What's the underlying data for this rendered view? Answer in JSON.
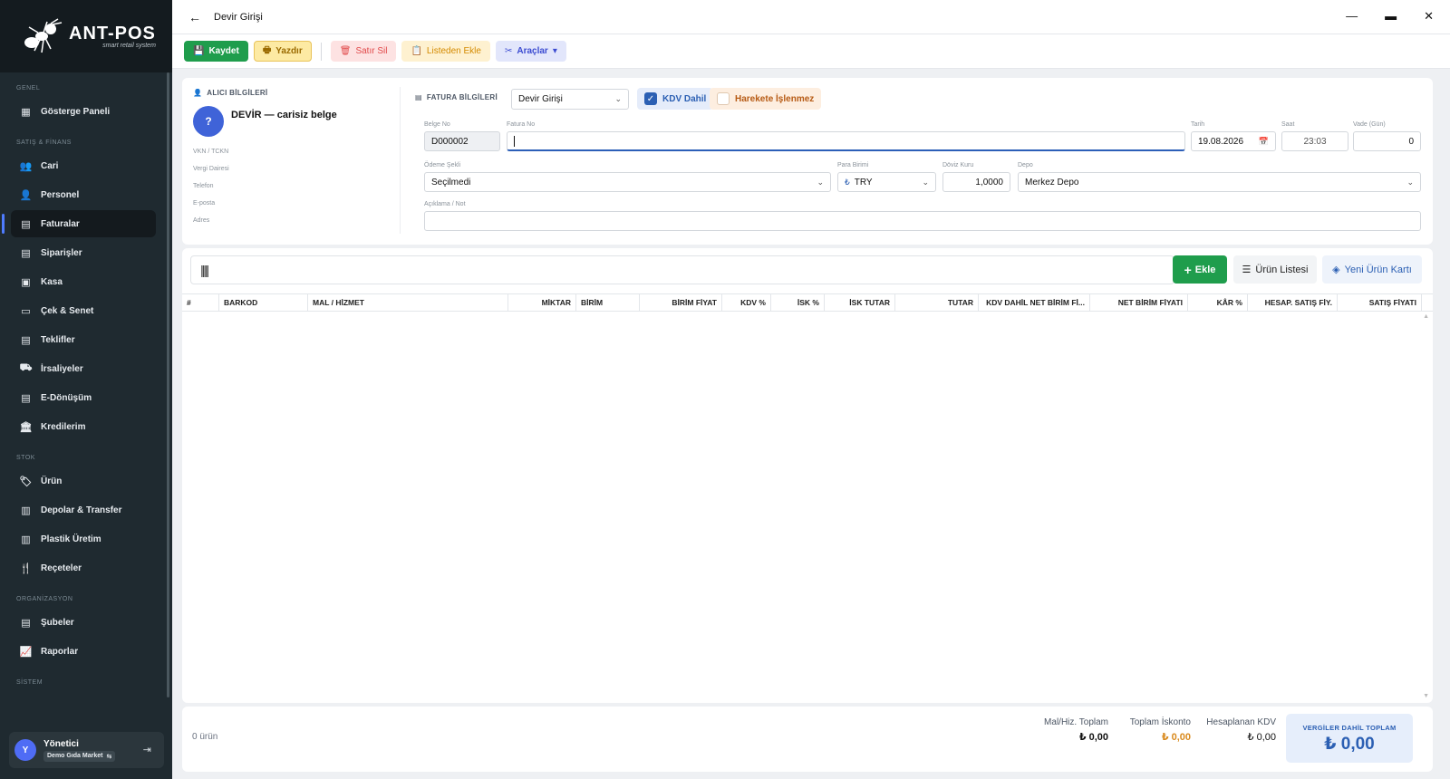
{
  "app": {
    "logo_title": "ANT-POS",
    "logo_subtitle": "smart retail system",
    "window_title": "Devir Girişi"
  },
  "sidebar": {
    "sections": {
      "genel": "GENEL",
      "satis": "SATIŞ & FİNANS",
      "stok": "STOK",
      "org": "ORGANİZASYON",
      "sistem": "SİSTEM"
    },
    "items": [
      {
        "label": "Gösterge Paneli",
        "icon": "dashboard-icon"
      },
      {
        "label": "Cari",
        "icon": "users-icon"
      },
      {
        "label": "Personel",
        "icon": "user-gear-icon"
      },
      {
        "label": "Faturalar",
        "icon": "invoice-icon",
        "active": true
      },
      {
        "label": "Siparişler",
        "icon": "order-icon"
      },
      {
        "label": "Kasa",
        "icon": "cashbox-icon"
      },
      {
        "label": "Çek & Senet",
        "icon": "cheque-icon"
      },
      {
        "label": "Teklifler",
        "icon": "offer-icon"
      },
      {
        "label": "İrsaliyeler",
        "icon": "truck-icon"
      },
      {
        "label": "E-Dönüşüm",
        "icon": "e-document-icon"
      },
      {
        "label": "Kredilerim",
        "icon": "bank-icon"
      },
      {
        "label": "Ürün",
        "icon": "tag-icon"
      },
      {
        "label": "Depolar & Transfer",
        "icon": "warehouse-icon"
      },
      {
        "label": "Plastik Üretim",
        "icon": "factory-icon"
      },
      {
        "label": "Reçeteler",
        "icon": "utensils-icon"
      },
      {
        "label": "Şubeler",
        "icon": "building-icon"
      },
      {
        "label": "Raporlar",
        "icon": "chart-line-icon"
      }
    ],
    "user": {
      "initial": "Y",
      "name": "Yönetici",
      "branch": "Demo Gıda Market",
      "switch_glyph": "⇆"
    }
  },
  "toolbar": {
    "save": "Kaydet",
    "print": "Yazdır",
    "delete_row": "Satır Sil",
    "add_from_list": "Listeden Ekle",
    "tools": "Araçlar"
  },
  "buyer": {
    "title": "ALICI BİLGİLERİ",
    "avatar": "?",
    "name": "DEVİR — carisiz belge",
    "fields": [
      "VKN / TCKN",
      "Vergi Dairesi",
      "Telefon",
      "E-posta",
      "Adres"
    ]
  },
  "invoice": {
    "title": "FATURA BİLGİLERİ",
    "type_value": "Devir Girişi",
    "kdv_dahil": "KDV Dahil",
    "kdv_dahil_checked": true,
    "hareket": "Harekete İşlenmez",
    "hareket_checked": false,
    "belge_no_label": "Belge No",
    "belge_no": "D000002",
    "fatura_no_label": "Fatura No",
    "fatura_no": "",
    "tarih_label": "Tarih",
    "tarih": "19.08.2026",
    "saat_label": "Saat",
    "saat": "23:03",
    "vade_label": "Vade (Gün)",
    "vade": "0",
    "odeme_label": "Ödeme Şekli",
    "odeme": "Seçilmedi",
    "para_label": "Para Birimi",
    "para_symbol": "₺",
    "para": "TRY",
    "doviz_label": "Döviz Kuru",
    "doviz": "1,0000",
    "depo_label": "Depo",
    "depo": "Merkez Depo",
    "aciklama_label": "Açıklama / Not",
    "aciklama": ""
  },
  "grid": {
    "add": "Ekle",
    "product_list": "Ürün Listesi",
    "new_card": "Yeni Ürün Kartı",
    "columns": [
      "#",
      "BARKOD",
      "MAL / HİZMET",
      "MİKTAR",
      "BİRİM",
      "BİRİM FİYAT",
      "KDV %",
      "İSK %",
      "İSK TUTAR",
      "TUTAR",
      "KDV DAHİL NET BİRİM Fİ...",
      "NET BİRİM FİYATI",
      "KÂR %",
      "HESAP. SATIŞ FİY.",
      "SATIŞ FİYATI"
    ],
    "rows": []
  },
  "totals": {
    "count": "0 ürün",
    "mal_label": "Mal/Hiz. Toplam",
    "mal": "₺ 0,00",
    "iskonto_label": "Toplam İskonto",
    "iskonto": "₺ 0,00",
    "kdv_label": "Hesaplanan KDV",
    "kdv": "₺ 0,00",
    "grand_label": "VERGİLER DAHİL TOPLAM",
    "grand": "₺ 0,00",
    "iskonto_color": "#d98a1e"
  }
}
